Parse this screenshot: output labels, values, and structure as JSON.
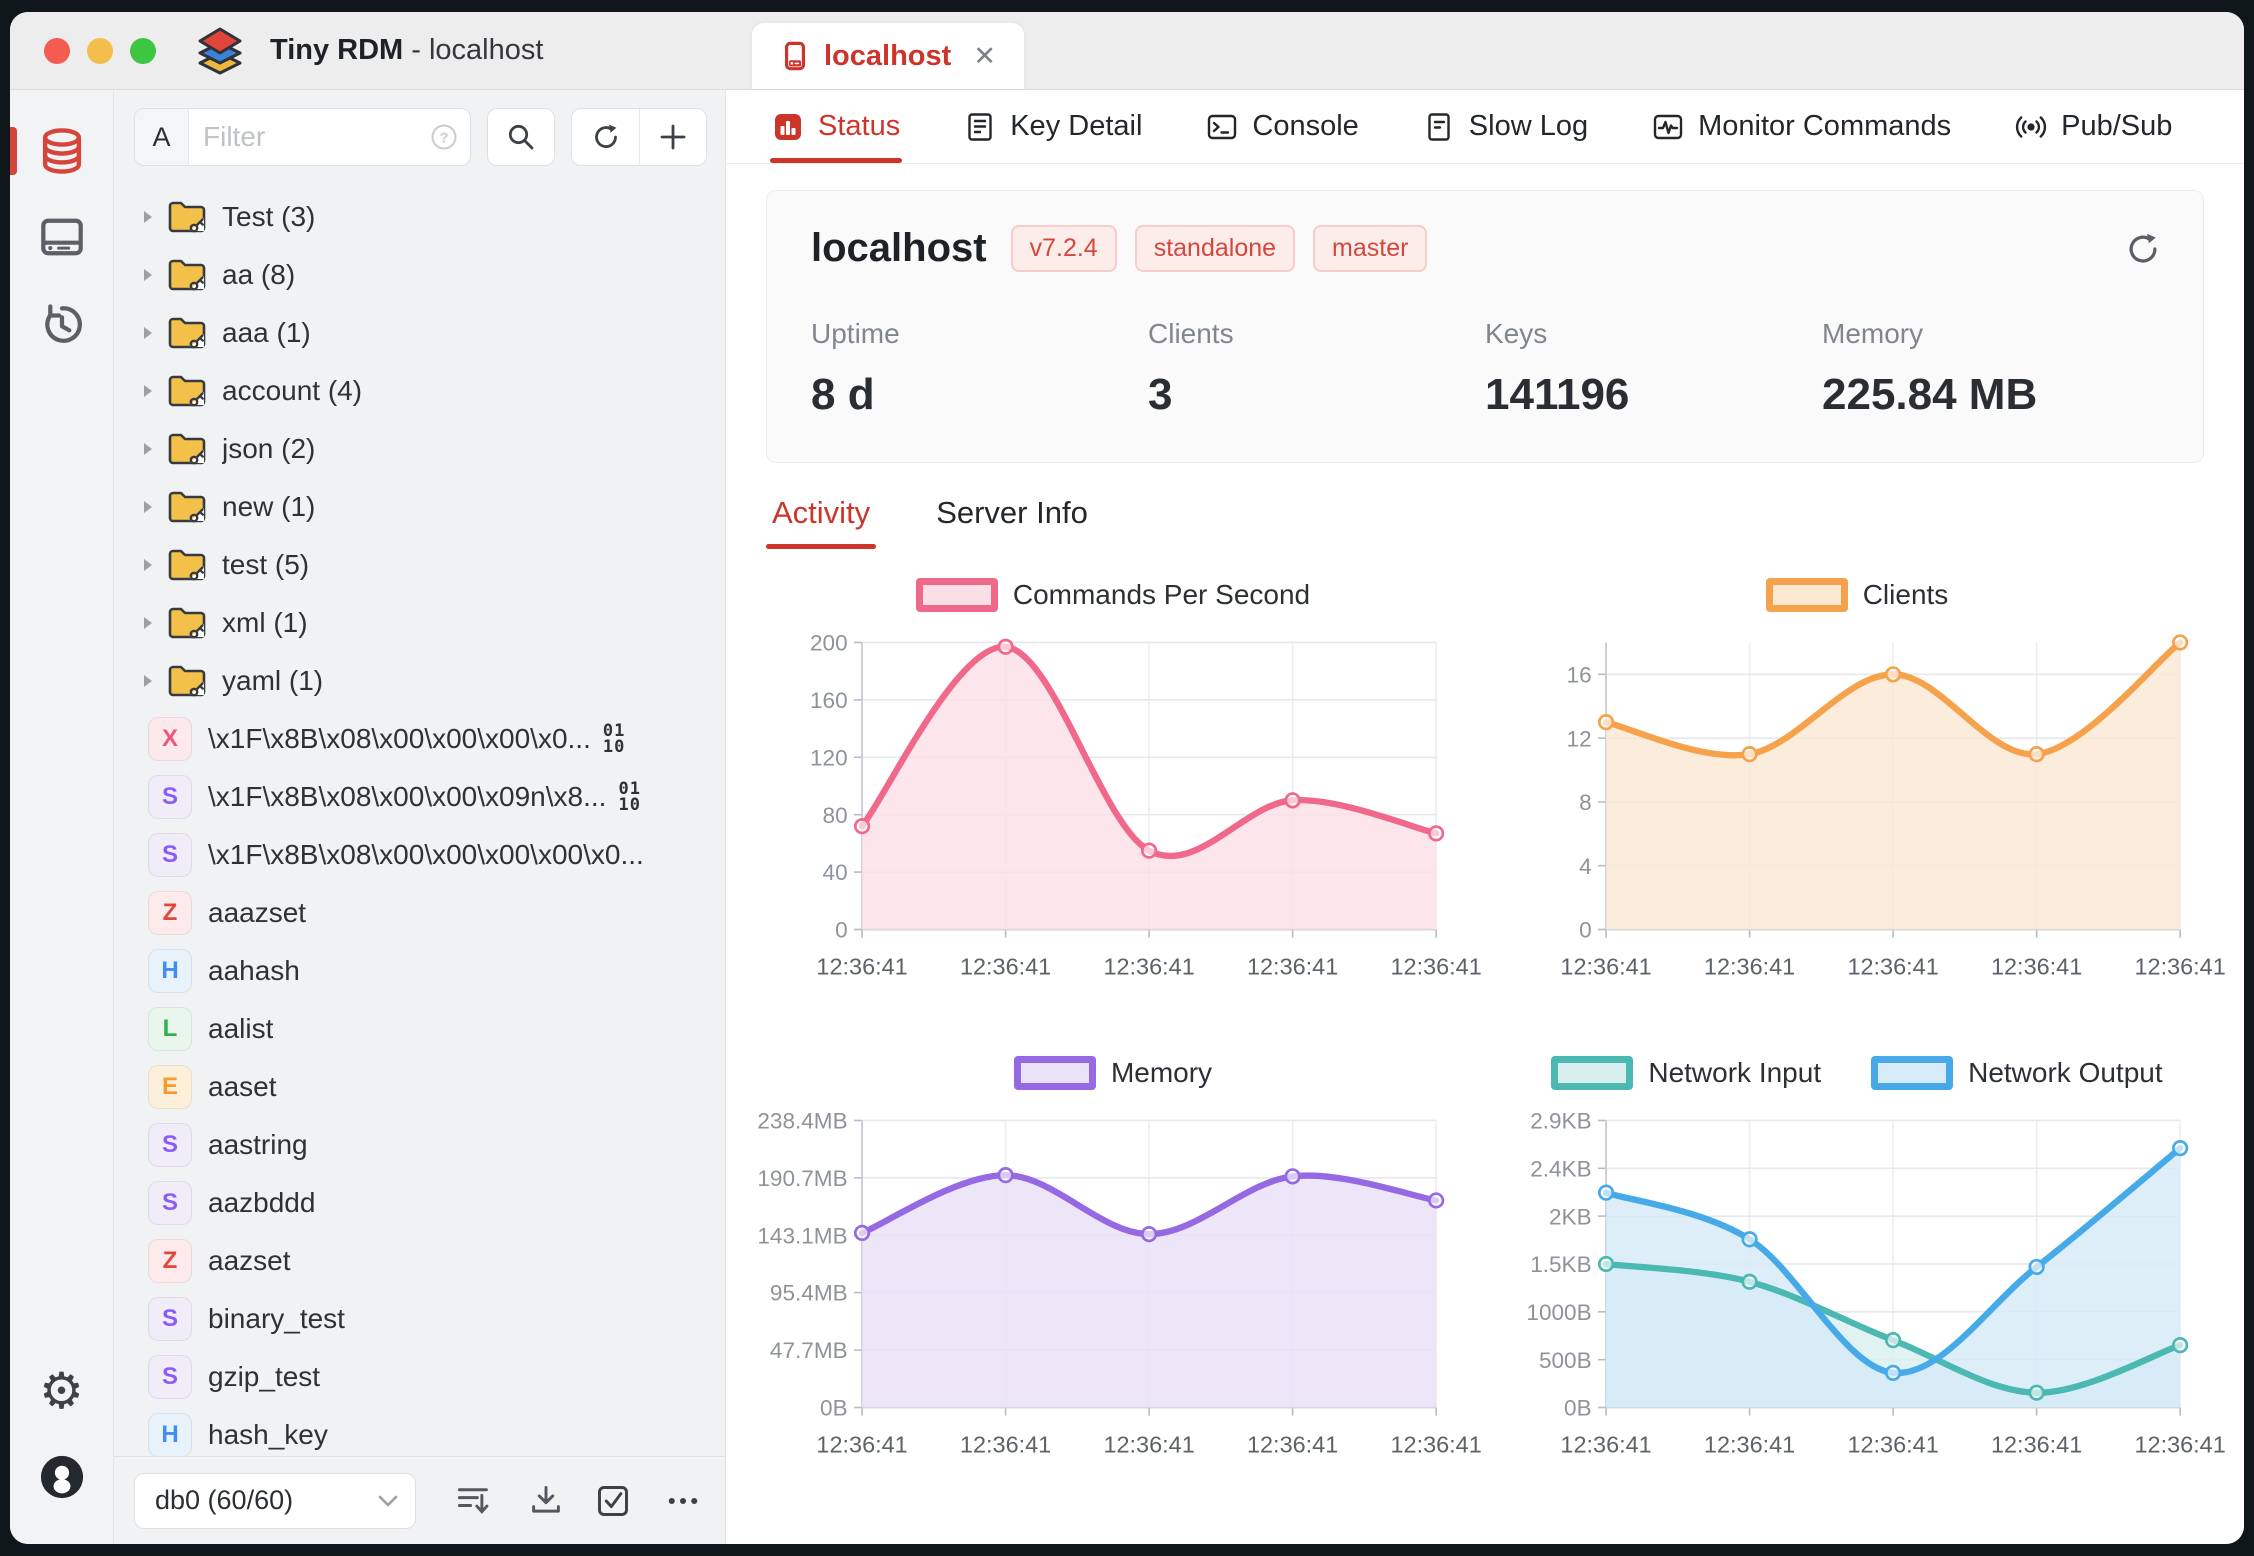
{
  "window": {
    "app_name": "Tiny RDM",
    "title_suffix": "- localhost"
  },
  "titlebar": {
    "connection_tab": {
      "label": "localhost",
      "close": "✕"
    }
  },
  "sidebar": {
    "filter": {
      "prefix": "A",
      "placeholder": "Filter"
    },
    "tree": [
      {
        "kind": "folder",
        "label": "Test (3)"
      },
      {
        "kind": "folder",
        "label": "aa (8)"
      },
      {
        "kind": "folder",
        "label": "aaa (1)"
      },
      {
        "kind": "folder",
        "label": "account (4)"
      },
      {
        "kind": "folder",
        "label": "json (2)"
      },
      {
        "kind": "folder",
        "label": "new (1)"
      },
      {
        "kind": "folder",
        "label": "test (5)"
      },
      {
        "kind": "folder",
        "label": "xml (1)"
      },
      {
        "kind": "folder",
        "label": "yaml (1)"
      },
      {
        "kind": "key",
        "type": "X",
        "color": "#f0557c",
        "bg": "#fce9ec",
        "binary": true,
        "label": "\\x1F\\x8B\\x08\\x00\\x00\\x00\\x0..."
      },
      {
        "kind": "key",
        "type": "S",
        "color": "#8b5cf6",
        "bg": "#f0edf9",
        "binary": true,
        "label": "\\x1F\\x8B\\x08\\x00\\x00\\x09n\\x8..."
      },
      {
        "kind": "key",
        "type": "S",
        "color": "#8b5cf6",
        "bg": "#f0edf9",
        "binary": false,
        "label": "\\x1F\\x8B\\x08\\x00\\x00\\x00\\x00\\x0..."
      },
      {
        "kind": "key",
        "type": "Z",
        "color": "#e0483e",
        "bg": "#fcebea",
        "binary": false,
        "label": "aaazset"
      },
      {
        "kind": "key",
        "type": "H",
        "color": "#3f8cf3",
        "bg": "#e7f2fb",
        "binary": false,
        "label": "aahash"
      },
      {
        "kind": "key",
        "type": "L",
        "color": "#2cb24e",
        "bg": "#e8f6ed",
        "binary": false,
        "label": "aalist"
      },
      {
        "kind": "key",
        "type": "E",
        "color": "#f59b2c",
        "bg": "#fdf0da",
        "binary": false,
        "label": "aaset"
      },
      {
        "kind": "key",
        "type": "S",
        "color": "#8b5cf6",
        "bg": "#f0edf9",
        "binary": false,
        "label": "aastring"
      },
      {
        "kind": "key",
        "type": "S",
        "color": "#8b5cf6",
        "bg": "#f0edf9",
        "binary": false,
        "label": "aazbddd"
      },
      {
        "kind": "key",
        "type": "Z",
        "color": "#e0483e",
        "bg": "#fcebea",
        "binary": false,
        "label": "aazset"
      },
      {
        "kind": "key",
        "type": "S",
        "color": "#8b5cf6",
        "bg": "#f0edf9",
        "binary": false,
        "label": "binary_test"
      },
      {
        "kind": "key",
        "type": "S",
        "color": "#8b5cf6",
        "bg": "#f0edf9",
        "binary": false,
        "label": "gzip_test"
      },
      {
        "kind": "key",
        "type": "H",
        "color": "#3f8cf3",
        "bg": "#e7f2fb",
        "binary": false,
        "label": "hash_key"
      }
    ],
    "footer": {
      "db_select": "db0 (60/60)"
    }
  },
  "nav_tabs": [
    {
      "label": "Status",
      "active": true
    },
    {
      "label": "Key Detail",
      "active": false
    },
    {
      "label": "Console",
      "active": false
    },
    {
      "label": "Slow Log",
      "active": false
    },
    {
      "label": "Monitor Commands",
      "active": false
    },
    {
      "label": "Pub/Sub",
      "active": false
    }
  ],
  "server": {
    "name": "localhost",
    "badges": [
      "v7.2.4",
      "standalone",
      "master"
    ],
    "stats": [
      {
        "label": "Uptime",
        "value": "8 d"
      },
      {
        "label": "Clients",
        "value": "3"
      },
      {
        "label": "Keys",
        "value": "141196"
      },
      {
        "label": "Memory",
        "value": "225.84 MB"
      }
    ]
  },
  "content_tabs": [
    {
      "label": "Activity",
      "active": true
    },
    {
      "label": "Server Info",
      "active": false
    }
  ],
  "chart_data": [
    {
      "type": "area",
      "title": "Commands Per Second",
      "x": [
        "12:36:41",
        "12:36:41",
        "12:36:41",
        "12:36:41",
        "12:36:41"
      ],
      "ymax": 200,
      "yticks": [
        {
          "v": 0,
          "label": "0"
        },
        {
          "v": 40,
          "label": "40"
        },
        {
          "v": 80,
          "label": "80"
        },
        {
          "v": 120,
          "label": "120"
        },
        {
          "v": 160,
          "label": "160"
        },
        {
          "v": 200,
          "label": "200"
        }
      ],
      "series": [
        {
          "name": "Commands Per Second",
          "color": "#f0688a",
          "fill": "#fbdfe6",
          "values": [
            72,
            197,
            55,
            90,
            67
          ]
        }
      ]
    },
    {
      "type": "area",
      "title": "Clients",
      "x": [
        "12:36:41",
        "12:36:41",
        "12:36:41",
        "12:36:41",
        "12:36:41"
      ],
      "ymax": 18,
      "yticks": [
        {
          "v": 0,
          "label": "0"
        },
        {
          "v": 4,
          "label": "4"
        },
        {
          "v": 8,
          "label": "8"
        },
        {
          "v": 12,
          "label": "12"
        },
        {
          "v": 16,
          "label": "16"
        }
      ],
      "series": [
        {
          "name": "Clients",
          "color": "#f6a14b",
          "fill": "#fae8d3",
          "values": [
            13,
            11,
            16,
            11,
            18
          ]
        }
      ]
    },
    {
      "type": "area",
      "title": "Memory",
      "x": [
        "12:36:41",
        "12:36:41",
        "12:36:41",
        "12:36:41",
        "12:36:41"
      ],
      "ymax": 238.4,
      "yticks": [
        {
          "v": 0,
          "label": "0B"
        },
        {
          "v": 47.7,
          "label": "47.7MB"
        },
        {
          "v": 95.4,
          "label": "95.4MB"
        },
        {
          "v": 143.1,
          "label": "143.1MB"
        },
        {
          "v": 190.7,
          "label": "190.7MB"
        },
        {
          "v": 238.4,
          "label": "238.4MB"
        }
      ],
      "series": [
        {
          "name": "Memory",
          "color": "#9569e3",
          "fill": "#e9e1f8",
          "values": [
            145,
            193,
            144,
            192,
            172
          ]
        }
      ]
    },
    {
      "type": "area",
      "title": "Network",
      "x": [
        "12:36:41",
        "12:36:41",
        "12:36:41",
        "12:36:41",
        "12:36:41"
      ],
      "ymax": 2.9,
      "yticks": [
        {
          "v": 0,
          "label": "0B"
        },
        {
          "v": 0.483,
          "label": "500B"
        },
        {
          "v": 0.967,
          "label": "1000B"
        },
        {
          "v": 1.45,
          "label": "1.5KB"
        },
        {
          "v": 1.933,
          "label": "2KB"
        },
        {
          "v": 2.417,
          "label": "2.4KB"
        },
        {
          "v": 2.9,
          "label": "2.9KB"
        }
      ],
      "series": [
        {
          "name": "Network Input",
          "color": "#4bb8b1",
          "fill": "#d9efee",
          "values": [
            1.45,
            1.27,
            0.68,
            0.15,
            0.63
          ]
        },
        {
          "name": "Network Output",
          "color": "#47aae8",
          "fill": "#d6eaf8",
          "values": [
            2.17,
            1.7,
            0.35,
            1.42,
            2.62
          ]
        }
      ]
    }
  ]
}
